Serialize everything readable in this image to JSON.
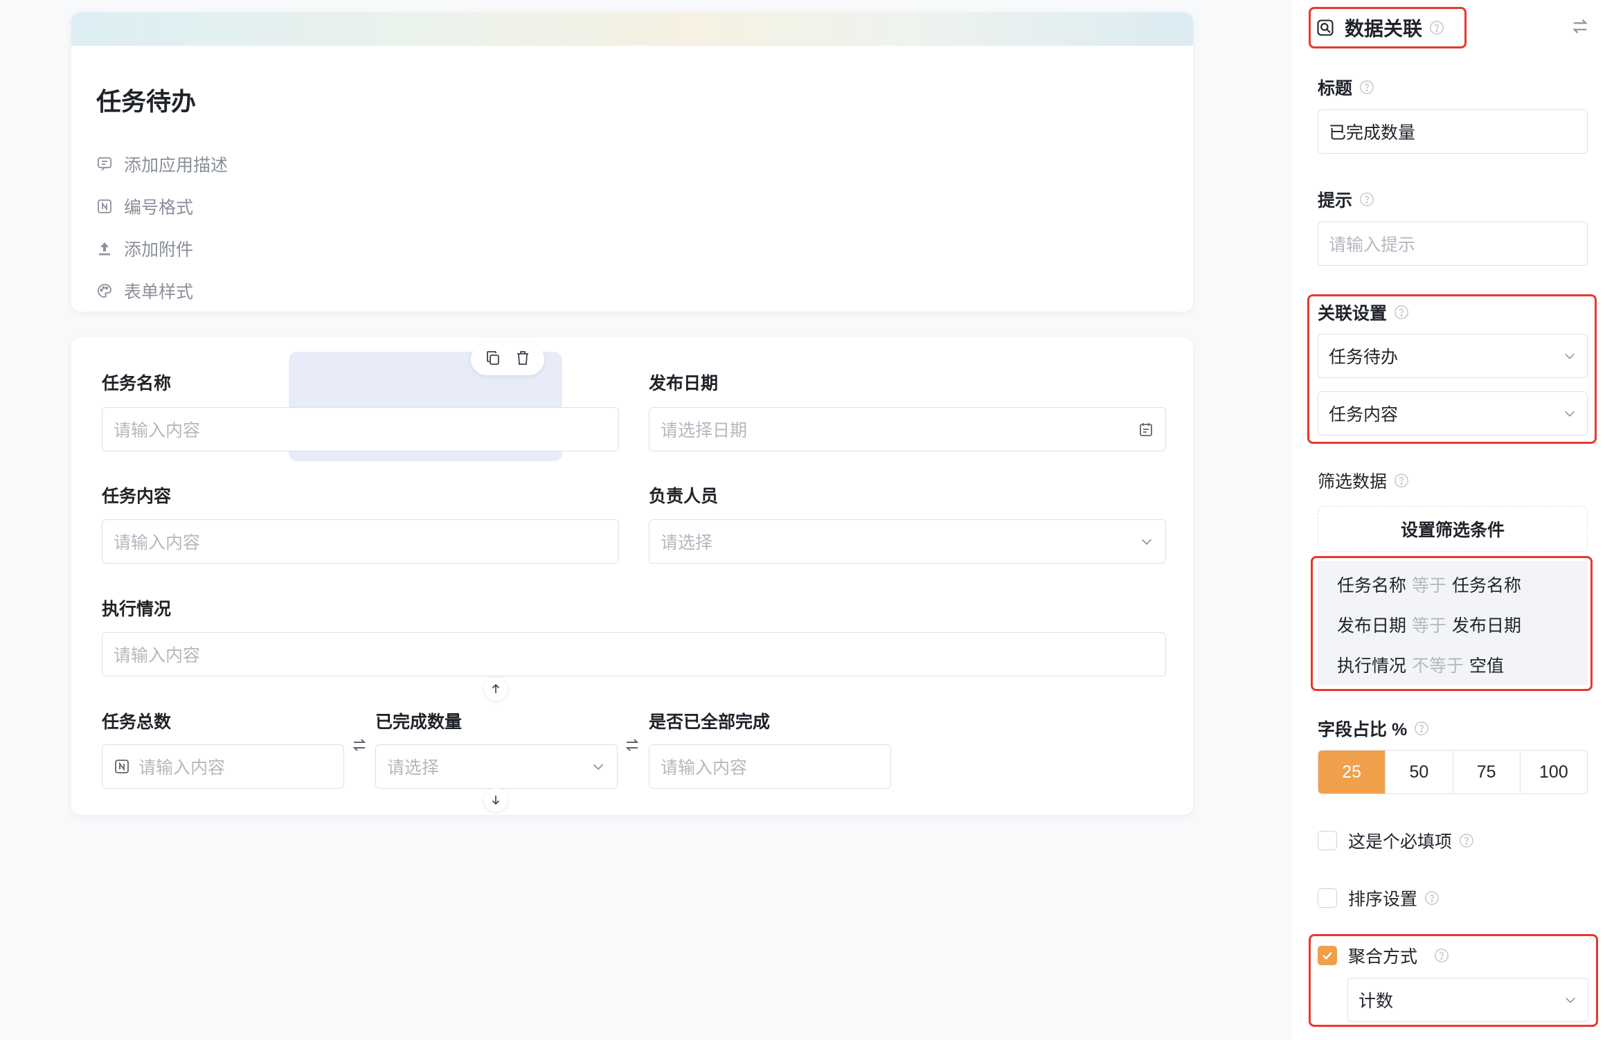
{
  "app": {
    "title": "任务待办",
    "meta_items": [
      {
        "label": "添加应用描述",
        "icon": "comment-icon"
      },
      {
        "label": "编号格式",
        "icon": "numbering-icon"
      },
      {
        "label": "添加附件",
        "icon": "upload-icon"
      },
      {
        "label": "表单样式",
        "icon": "palette-icon"
      }
    ]
  },
  "form": {
    "task_name": {
      "label": "任务名称",
      "placeholder": "请输入内容"
    },
    "publish_date": {
      "label": "发布日期",
      "placeholder": "请选择日期"
    },
    "task_content": {
      "label": "任务内容",
      "placeholder": "请输入内容"
    },
    "owner": {
      "label": "负责人员",
      "placeholder": "请选择"
    },
    "execution": {
      "label": "执行情况",
      "placeholder": "请输入内容"
    },
    "task_total": {
      "label": "任务总数",
      "placeholder": "请输入内容"
    },
    "completed_count": {
      "label": "已完成数量",
      "placeholder": "请选择"
    },
    "all_completed": {
      "label": "是否已全部完成",
      "placeholder": "请输入内容"
    }
  },
  "panel": {
    "header": {
      "title": "数据关联"
    },
    "title_field": {
      "label": "标题",
      "value": "已完成数量"
    },
    "hint_field": {
      "label": "提示",
      "placeholder": "请输入提示"
    },
    "link_settings": {
      "label": "关联设置",
      "form_value": "任务待办",
      "field_value": "任务内容"
    },
    "filter": {
      "label": "筛选数据",
      "button": "设置筛选条件",
      "conditions": [
        {
          "left": "任务名称",
          "op": "等于",
          "right": "任务名称"
        },
        {
          "left": "发布日期",
          "op": "等于",
          "right": "发布日期"
        },
        {
          "left": "执行情况",
          "op": "不等于",
          "right": "空值"
        }
      ]
    },
    "width_ratio": {
      "label": "字段占比 %",
      "options": [
        "25",
        "50",
        "75",
        "100"
      ],
      "selected": "25"
    },
    "required": {
      "label": "这是个必填项",
      "checked": false
    },
    "sort": {
      "label": "排序设置",
      "checked": false
    },
    "aggregate": {
      "label": "聚合方式",
      "checked": true,
      "value": "计数"
    }
  },
  "colors": {
    "accent": "#f0a04b",
    "highlight_box": "#e8382d",
    "selected_field_bg": "#e8ecf8"
  }
}
